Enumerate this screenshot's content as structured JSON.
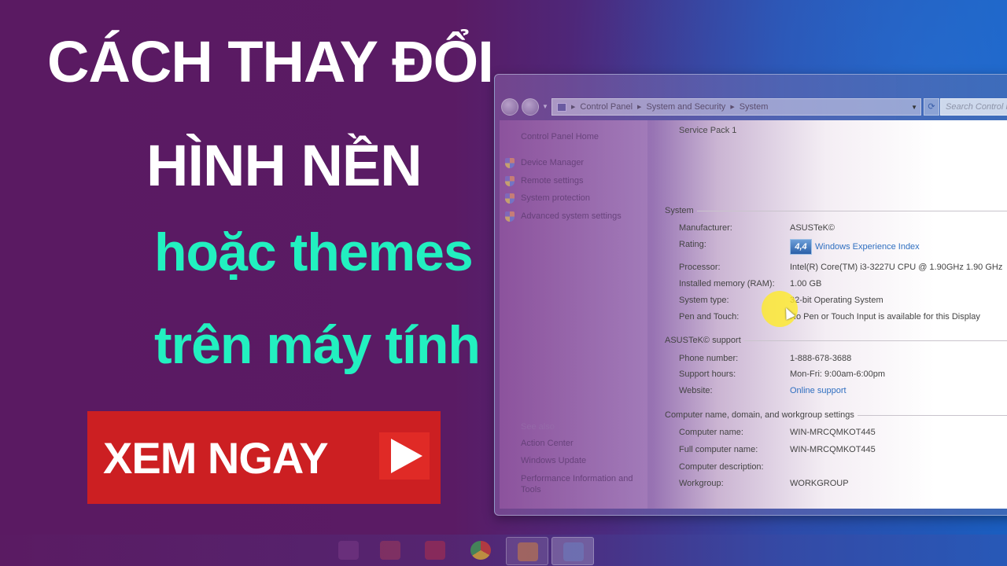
{
  "headline": {
    "line1": "CÁCH THAY ĐỔI",
    "line2": "HÌNH NỀN",
    "line3": "hoặc themes",
    "line4": "trên máy tính"
  },
  "cta": {
    "label": "XEM NGAY",
    "icon": "play-icon"
  },
  "colors": {
    "background": "#5a1a62",
    "headline_white": "#ffffff",
    "headline_accent": "#22f0c0",
    "cta_red": "#cc1f22",
    "link_blue": "#2f6fc0"
  },
  "window": {
    "breadcrumb": [
      "Control Panel",
      "System and Security",
      "System"
    ],
    "search_placeholder": "Search Control P",
    "left_pane": {
      "home": "Control Panel Home",
      "tasks": [
        "Device Manager",
        "Remote settings",
        "System protection",
        "Advanced system settings"
      ],
      "see_also_label": "See also",
      "see_also": [
        "Action Center",
        "Windows Update",
        "Performance Information and Tools"
      ]
    },
    "service_pack": "Service Pack 1",
    "sections": {
      "system": {
        "title": "System",
        "rows": [
          {
            "label": "Manufacturer:",
            "value": "ASUSTeK©"
          },
          {
            "label": "Rating:",
            "badge": "4,4",
            "value": "Windows Experience Index"
          },
          {
            "label": "Processor:",
            "value": "Intel(R) Core(TM) i3-3227U CPU @ 1.90GHz   1.90 GHz"
          },
          {
            "label": "Installed memory (RAM):",
            "value": "1.00 GB"
          },
          {
            "label": "System type:",
            "value": "32-bit Operating System"
          },
          {
            "label": "Pen and Touch:",
            "value": "No Pen or Touch Input is available for this Display"
          }
        ]
      },
      "support": {
        "title": "ASUSTeK© support",
        "rows": [
          {
            "label": "Phone number:",
            "value": "1-888-678-3688"
          },
          {
            "label": "Support hours:",
            "value": "Mon-Fri: 9:00am-6:00pm"
          },
          {
            "label": "Website:",
            "value": "Online support"
          }
        ]
      },
      "computer": {
        "title": "Computer name, domain, and workgroup settings",
        "rows": [
          {
            "label": "Computer name:",
            "value": "WIN-MRCQMKOT445"
          },
          {
            "label": "Full computer name:",
            "value": "WIN-MRCQMKOT445"
          },
          {
            "label": "Computer description:",
            "value": ""
          },
          {
            "label": "Workgroup:",
            "value": "WORKGROUP"
          }
        ]
      }
    }
  },
  "taskbar": {
    "icons": [
      "explorer-icon",
      "media-player-icon",
      "video-icon",
      "chrome-icon",
      "files-icon",
      "control-panel-icon"
    ]
  }
}
